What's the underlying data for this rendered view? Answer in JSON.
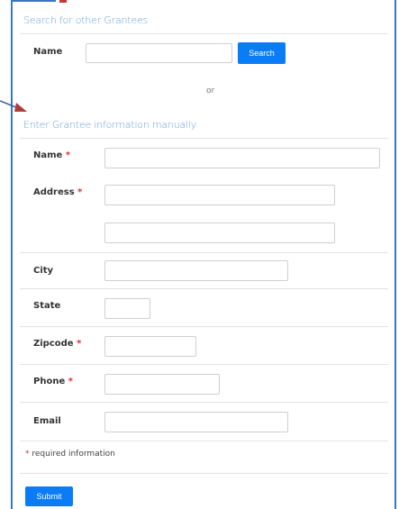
{
  "search_section": {
    "title": "Search for other Grantees",
    "name_label": "Name",
    "name_value": "",
    "search_button": "Search",
    "or_text": "or"
  },
  "manual_section": {
    "title": "Enter Grantee information manually",
    "required_marker": "*",
    "fields": {
      "name": {
        "label": "Name",
        "value": ""
      },
      "address": {
        "label": "Address",
        "line1": "",
        "line2": ""
      },
      "city": {
        "label": "City",
        "value": ""
      },
      "state": {
        "label": "State",
        "value": ""
      },
      "zipcode": {
        "label": "Zipcode",
        "value": ""
      },
      "phone": {
        "label": "Phone",
        "value": ""
      },
      "email": {
        "label": "Email",
        "value": ""
      }
    },
    "required_note": "required information",
    "submit_button": "Submit"
  },
  "colors": {
    "accent": "#0a7cf5",
    "frame": "#3a76c4",
    "required": "#d9302e",
    "annotation_arrow": "#b03a3a"
  }
}
